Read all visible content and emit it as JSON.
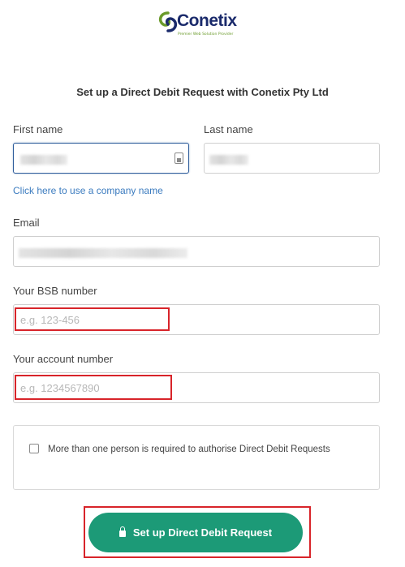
{
  "brand": {
    "name": "Conetix",
    "tagline": "Premier Web Solution Provider"
  },
  "form": {
    "title": "Set up a Direct Debit Request with Conetix Pty Ltd",
    "first_name": {
      "label": "First name",
      "value": ""
    },
    "last_name": {
      "label": "Last name",
      "value": ""
    },
    "company_link": "Click here to use a company name",
    "email": {
      "label": "Email",
      "value": ""
    },
    "bsb": {
      "label": "Your BSB number",
      "placeholder": "e.g. 123-456"
    },
    "account": {
      "label": "Your account number",
      "placeholder": "e.g. 1234567890"
    },
    "multi_auth": {
      "checked": false,
      "text": "More than one person is required to authorise Direct Debit Requests"
    },
    "submit_label": "Set up Direct Debit Request"
  },
  "colors": {
    "accent": "#1c9a77",
    "link": "#3b7bbf",
    "highlight": "#d8242a",
    "focus": "#2d5c9b",
    "logo_text": "#1a2a6b",
    "logo_green": "#6a9a2a"
  },
  "icons": {
    "field_icon": "keyboard-icon",
    "submit_icon": "lock-icon"
  }
}
